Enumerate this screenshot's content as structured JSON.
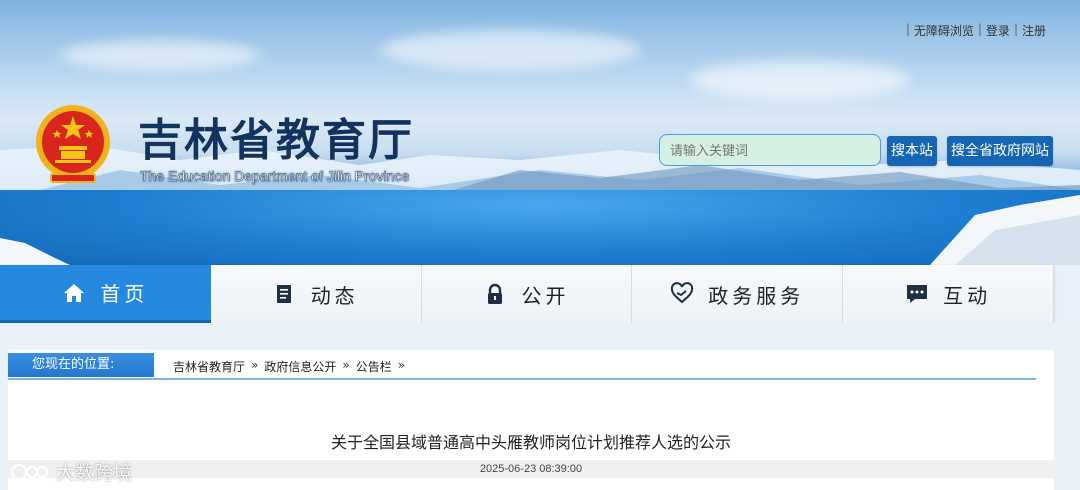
{
  "top_links": [
    "无障碍浏览",
    "登录",
    "注册"
  ],
  "site": {
    "title": "吉林省教育厅",
    "subtitle": "The Education Department of Jilin Province"
  },
  "search": {
    "placeholder": "请输入关键词",
    "site_button": "搜本站",
    "all_button": "搜全省政府网站"
  },
  "nav": [
    {
      "label": "首页",
      "icon": "home-icon"
    },
    {
      "label": "动态",
      "icon": "document-icon"
    },
    {
      "label": "公开",
      "icon": "lock-icon"
    },
    {
      "label": "政务服务",
      "icon": "heart-hand-icon"
    },
    {
      "label": "互动",
      "icon": "chat-icon"
    }
  ],
  "location": {
    "label": "您现在的位置:",
    "crumbs": [
      "吉林省教育厅",
      "政府信息公开",
      "公告栏"
    ],
    "separator": "»"
  },
  "article": {
    "title": "关于全国县域普通高中头雁教师岗位计划推荐人选的公示",
    "date": "2025-06-23 08:39:00"
  },
  "watermark": "大数跨境",
  "colors": {
    "nav_active": "#2589e0",
    "title": "#13335f",
    "button": "#1565b3"
  }
}
